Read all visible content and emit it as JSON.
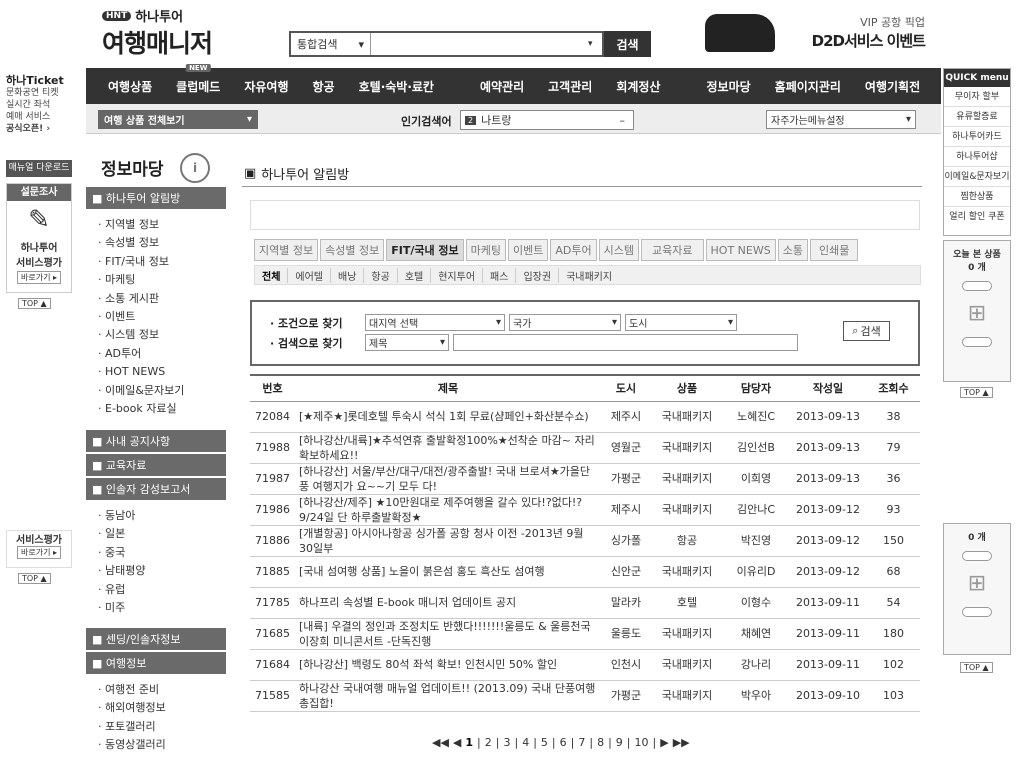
{
  "header": {
    "logo_badge": "HNT",
    "logo_small": "하나투어",
    "logo_big": "여행매니저",
    "search_select": "통합검색",
    "search_button": "검색",
    "ad_line1": "VIP 공항 픽업",
    "ad_line2": "D2D서비스 이벤트"
  },
  "nav": {
    "new_badge": "NEW",
    "items": [
      "여행상품",
      "클럽메드",
      "자유여행",
      "항공",
      "호텔·숙박·료칸",
      "예약관리",
      "고객관리",
      "회계정산",
      "정보마당",
      "홈페이지관리",
      "여행기획전"
    ]
  },
  "subbar": {
    "all_products": "여행 상품 전체보기",
    "popular_label": "인기검색어",
    "popular_num": "2",
    "popular_value": "나트랑",
    "popular_dash": "–",
    "favorites": "자주가는메뉴설정"
  },
  "left_col": {
    "ticket_logo": "하나Ticket",
    "ticket_text": [
      "문화공연 티켓",
      "실시간 좌석",
      "예매 서비스",
      "공식오픈! ›"
    ],
    "manual_download": "매뉴얼 다운로드",
    "survey": "설문조사",
    "eval_title1": "하나투어",
    "eval_title2": "서비스평가",
    "go_button": "바로가기 ▸",
    "top": "TOP ▲",
    "eval_title_b": "서비스평가",
    "go_button_b": "바로가기 ▸",
    "top_b": "TOP ▲"
  },
  "sidebar": {
    "title": "정보마당",
    "info_icon": "i",
    "sections": [
      {
        "label": "하나투어 알림방"
      },
      {
        "label": "사내 공지사항"
      },
      {
        "label": "교육자료"
      },
      {
        "label": "인솔자 감성보고서"
      },
      {
        "label": "센딩/인솔자정보"
      },
      {
        "label": "여행정보"
      }
    ],
    "group1": [
      "지역별 정보",
      "속성별 정보",
      "FIT/국내 정보",
      "마케팅",
      "소통 게시판",
      "이벤트",
      "시스템 정보",
      "AD투어",
      "HOT NEWS",
      "이메일&문자보기",
      "E-book 자료실"
    ],
    "group2": [
      "동남아",
      "일본",
      "중국",
      "남태평양",
      "유럽",
      "미주"
    ],
    "group3": [
      "여행전 준비",
      "해외여행정보",
      "포토갤러리",
      "동영상갤러리"
    ]
  },
  "main": {
    "title": "하나투어 알림방",
    "tabs": [
      "지역별 정보",
      "속성별 정보",
      "FIT/국내 정보",
      "마케팅",
      "이벤트",
      "AD투어",
      "시스템",
      "교육자료",
      "HOT NEWS",
      "소통",
      "인쇄물"
    ],
    "subtabs": [
      "전체",
      "에어텔",
      "배낭",
      "항공",
      "호텔",
      "현지투어",
      "패스",
      "입장권",
      "국내패키지"
    ],
    "search": {
      "cond_label": "· 조건으로 찾기",
      "search_label": "· 검색으로 찾기",
      "region": "대지역 선택",
      "country": "국가",
      "city": "도시",
      "field": "제목",
      "button": "검색"
    },
    "columns": [
      "번호",
      "제목",
      "도시",
      "상품",
      "담당자",
      "작성일",
      "조회수"
    ],
    "rows": [
      {
        "no": "72084",
        "title": "[★제주★]롯데호텔 투숙시 석식 1회 무료(샴페인+화산분수쇼)",
        "city": "제주시",
        "product": "국내패키지",
        "manager": "노혜진C",
        "date": "2013-09-13",
        "views": "38"
      },
      {
        "no": "71988",
        "title": "[하나강산/내륙]★추석연휴 출발확정100%★선착순 마감~ 자리확보하세요!!",
        "city": "영월군",
        "product": "국내패키지",
        "manager": "김인선B",
        "date": "2013-09-13",
        "views": "79"
      },
      {
        "no": "71987",
        "title": "[하나강산] 서울/부산/대구/대전/광주출발! 국내 브로셔★가을단풍 여행지가 요~~기 모두 다!",
        "city": "가평군",
        "product": "국내패키지",
        "manager": "이희영",
        "date": "2013-09-13",
        "views": "36"
      },
      {
        "no": "71986",
        "title": "[하나강산/제주] ★10만원대로 제주여행을 갈수 있다!?없다!? 9/24일 단 하루출발확정★",
        "city": "제주시",
        "product": "국내패키지",
        "manager": "김안나C",
        "date": "2013-09-12",
        "views": "93"
      },
      {
        "no": "71886",
        "title": "[개별항공] 아시아나항공 싱가폴 공항 청사 이전 -2013년 9월 30일부",
        "city": "싱가폴",
        "product": "항공",
        "manager": "박진영",
        "date": "2013-09-12",
        "views": "150"
      },
      {
        "no": "71885",
        "title": "[국내 섬여행 상품] 노을이 붉은섬 홍도 흑산도 섬여행",
        "city": "신안군",
        "product": "국내패키지",
        "manager": "이유리D",
        "date": "2013-09-12",
        "views": "68"
      },
      {
        "no": "71785",
        "title": "하나프리 속성별 E-book 매니저 업데이트 공지",
        "city": "말라카",
        "product": "호텔",
        "manager": "이형수",
        "date": "2013-09-11",
        "views": "54"
      },
      {
        "no": "71685",
        "title": "[내륙] 우결의 정인과 조정치도 반했다!!!!!!!울릉도 & 울릉천국 이장희 미니콘서트 -단독진행",
        "city": "울릉도",
        "product": "국내패키지",
        "manager": "채혜연",
        "date": "2013-09-11",
        "views": "180"
      },
      {
        "no": "71684",
        "title": "[하나강산] 백령도 80석 좌석 확보! 인천시민 50% 할인",
        "city": "인천시",
        "product": "국내패키지",
        "manager": "강나리",
        "date": "2013-09-11",
        "views": "102"
      },
      {
        "no": "71585",
        "title": "하나강산 국내여행 매뉴얼 업데이트!! (2013.09) 국내 단풍여행 총집합!",
        "city": "가평군",
        "product": "국내패키지",
        "manager": "박우아",
        "date": "2013-09-10",
        "views": "103"
      }
    ],
    "pagination": {
      "first": "◀◀",
      "prev": "◀",
      "pages": [
        "1",
        "2",
        "3",
        "4",
        "5",
        "6",
        "7",
        "8",
        "9",
        "10"
      ],
      "next": "▶",
      "last": "▶▶"
    }
  },
  "quick": {
    "title": "QUICK menu",
    "items": [
      "무이자 할부",
      "유류할증료",
      "하나투어카드",
      "하나투어샵",
      "이메일&문자보기",
      "찜한상품",
      "얼리 할인 쿠폰"
    ],
    "today_label": "오늘 본 상품",
    "today_count": "0 개",
    "top": "TOP ▲",
    "today_count_b": "0 개",
    "top_b": "TOP ▲"
  }
}
